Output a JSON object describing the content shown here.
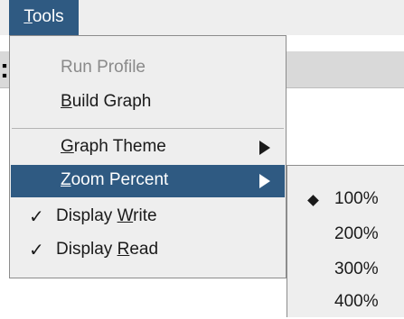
{
  "menubar": {
    "tools": {
      "mnemonic": "T",
      "rest": "ools"
    }
  },
  "background": {
    "glyph": ":"
  },
  "tools_menu": {
    "run_profile": "Run Profile",
    "build_graph": {
      "mnemonic": "B",
      "rest": "uild Graph"
    },
    "graph_theme": {
      "mnemonic": "G",
      "rest": "raph Theme"
    },
    "zoom_percent": {
      "mnemonic": "Z",
      "rest": "oom Percent"
    },
    "display_write": {
      "check": "✓",
      "prefix": "Display ",
      "mnemonic": "W",
      "rest": "rite"
    },
    "display_read": {
      "check": "✓",
      "prefix": "Display ",
      "mnemonic": "R",
      "rest": "ead"
    }
  },
  "zoom_submenu": {
    "selected": "100%",
    "options": [
      "100%",
      "200%",
      "300%",
      "400%"
    ]
  },
  "colors": {
    "selection": "#2f5a82",
    "menu_bg": "#eeeeee"
  }
}
